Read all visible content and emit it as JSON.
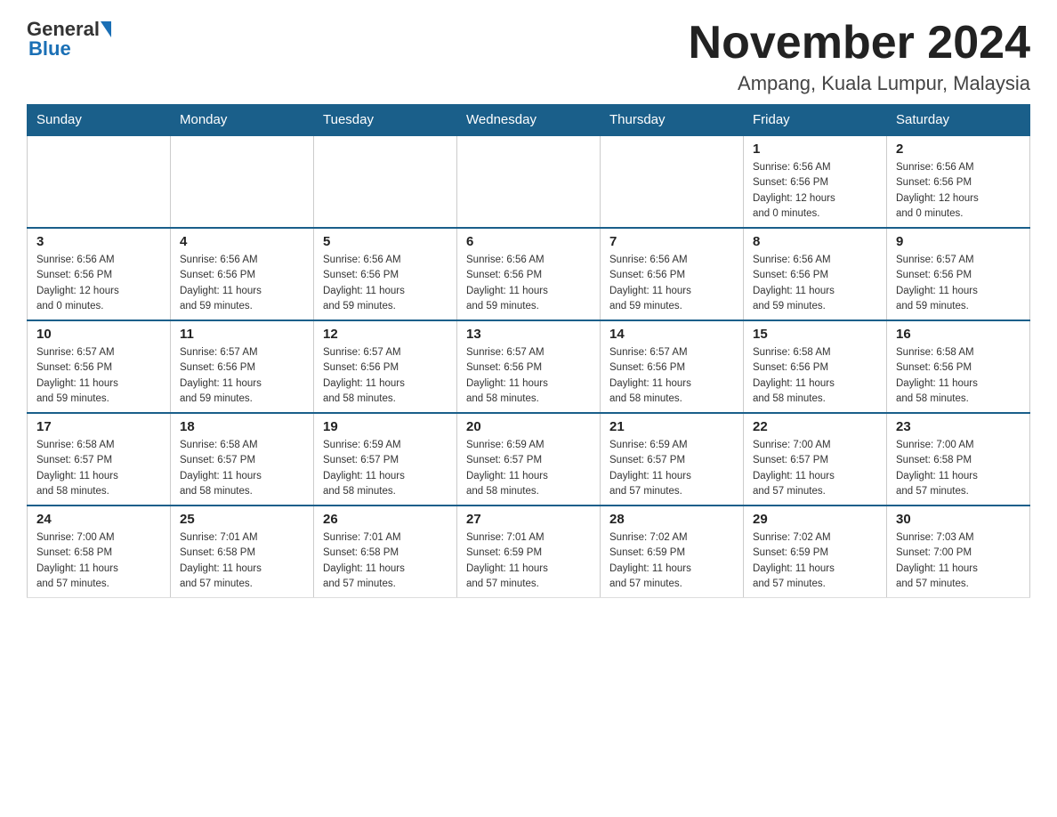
{
  "logo": {
    "general": "General",
    "blue": "Blue"
  },
  "header": {
    "title": "November 2024",
    "subtitle": "Ampang, Kuala Lumpur, Malaysia"
  },
  "weekdays": [
    "Sunday",
    "Monday",
    "Tuesday",
    "Wednesday",
    "Thursday",
    "Friday",
    "Saturday"
  ],
  "weeks": [
    [
      {
        "day": "",
        "info": ""
      },
      {
        "day": "",
        "info": ""
      },
      {
        "day": "",
        "info": ""
      },
      {
        "day": "",
        "info": ""
      },
      {
        "day": "",
        "info": ""
      },
      {
        "day": "1",
        "info": "Sunrise: 6:56 AM\nSunset: 6:56 PM\nDaylight: 12 hours\nand 0 minutes."
      },
      {
        "day": "2",
        "info": "Sunrise: 6:56 AM\nSunset: 6:56 PM\nDaylight: 12 hours\nand 0 minutes."
      }
    ],
    [
      {
        "day": "3",
        "info": "Sunrise: 6:56 AM\nSunset: 6:56 PM\nDaylight: 12 hours\nand 0 minutes."
      },
      {
        "day": "4",
        "info": "Sunrise: 6:56 AM\nSunset: 6:56 PM\nDaylight: 11 hours\nand 59 minutes."
      },
      {
        "day": "5",
        "info": "Sunrise: 6:56 AM\nSunset: 6:56 PM\nDaylight: 11 hours\nand 59 minutes."
      },
      {
        "day": "6",
        "info": "Sunrise: 6:56 AM\nSunset: 6:56 PM\nDaylight: 11 hours\nand 59 minutes."
      },
      {
        "day": "7",
        "info": "Sunrise: 6:56 AM\nSunset: 6:56 PM\nDaylight: 11 hours\nand 59 minutes."
      },
      {
        "day": "8",
        "info": "Sunrise: 6:56 AM\nSunset: 6:56 PM\nDaylight: 11 hours\nand 59 minutes."
      },
      {
        "day": "9",
        "info": "Sunrise: 6:57 AM\nSunset: 6:56 PM\nDaylight: 11 hours\nand 59 minutes."
      }
    ],
    [
      {
        "day": "10",
        "info": "Sunrise: 6:57 AM\nSunset: 6:56 PM\nDaylight: 11 hours\nand 59 minutes."
      },
      {
        "day": "11",
        "info": "Sunrise: 6:57 AM\nSunset: 6:56 PM\nDaylight: 11 hours\nand 59 minutes."
      },
      {
        "day": "12",
        "info": "Sunrise: 6:57 AM\nSunset: 6:56 PM\nDaylight: 11 hours\nand 58 minutes."
      },
      {
        "day": "13",
        "info": "Sunrise: 6:57 AM\nSunset: 6:56 PM\nDaylight: 11 hours\nand 58 minutes."
      },
      {
        "day": "14",
        "info": "Sunrise: 6:57 AM\nSunset: 6:56 PM\nDaylight: 11 hours\nand 58 minutes."
      },
      {
        "day": "15",
        "info": "Sunrise: 6:58 AM\nSunset: 6:56 PM\nDaylight: 11 hours\nand 58 minutes."
      },
      {
        "day": "16",
        "info": "Sunrise: 6:58 AM\nSunset: 6:56 PM\nDaylight: 11 hours\nand 58 minutes."
      }
    ],
    [
      {
        "day": "17",
        "info": "Sunrise: 6:58 AM\nSunset: 6:57 PM\nDaylight: 11 hours\nand 58 minutes."
      },
      {
        "day": "18",
        "info": "Sunrise: 6:58 AM\nSunset: 6:57 PM\nDaylight: 11 hours\nand 58 minutes."
      },
      {
        "day": "19",
        "info": "Sunrise: 6:59 AM\nSunset: 6:57 PM\nDaylight: 11 hours\nand 58 minutes."
      },
      {
        "day": "20",
        "info": "Sunrise: 6:59 AM\nSunset: 6:57 PM\nDaylight: 11 hours\nand 58 minutes."
      },
      {
        "day": "21",
        "info": "Sunrise: 6:59 AM\nSunset: 6:57 PM\nDaylight: 11 hours\nand 57 minutes."
      },
      {
        "day": "22",
        "info": "Sunrise: 7:00 AM\nSunset: 6:57 PM\nDaylight: 11 hours\nand 57 minutes."
      },
      {
        "day": "23",
        "info": "Sunrise: 7:00 AM\nSunset: 6:58 PM\nDaylight: 11 hours\nand 57 minutes."
      }
    ],
    [
      {
        "day": "24",
        "info": "Sunrise: 7:00 AM\nSunset: 6:58 PM\nDaylight: 11 hours\nand 57 minutes."
      },
      {
        "day": "25",
        "info": "Sunrise: 7:01 AM\nSunset: 6:58 PM\nDaylight: 11 hours\nand 57 minutes."
      },
      {
        "day": "26",
        "info": "Sunrise: 7:01 AM\nSunset: 6:58 PM\nDaylight: 11 hours\nand 57 minutes."
      },
      {
        "day": "27",
        "info": "Sunrise: 7:01 AM\nSunset: 6:59 PM\nDaylight: 11 hours\nand 57 minutes."
      },
      {
        "day": "28",
        "info": "Sunrise: 7:02 AM\nSunset: 6:59 PM\nDaylight: 11 hours\nand 57 minutes."
      },
      {
        "day": "29",
        "info": "Sunrise: 7:02 AM\nSunset: 6:59 PM\nDaylight: 11 hours\nand 57 minutes."
      },
      {
        "day": "30",
        "info": "Sunrise: 7:03 AM\nSunset: 7:00 PM\nDaylight: 11 hours\nand 57 minutes."
      }
    ]
  ]
}
